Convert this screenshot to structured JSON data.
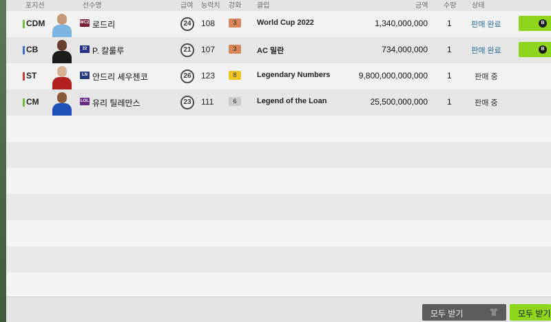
{
  "header": {
    "position": "포지션",
    "player": "선수명",
    "pay": "급여",
    "ovr": "능력치",
    "grade": "강화",
    "club": "클럽",
    "price": "금액",
    "qty": "수량",
    "status": "상태"
  },
  "rows": [
    {
      "position": "CDM",
      "position_color": "#6fbf3a",
      "season": "WC22",
      "season_color": "#7a1f35",
      "name": "로드리",
      "pay": "24",
      "ovr": "108",
      "grade": "3",
      "grade_color": "#d9865a",
      "club": "World Cup 2022",
      "price": "1,340,000,000",
      "qty": "1",
      "status": "판매 완료",
      "status_type": "done",
      "receive": true,
      "coin_icon": "coin-icon",
      "kit_colors": [
        "#7cb5e0",
        "#c49a7a"
      ]
    },
    {
      "position": "CB",
      "position_color": "#3e6fc9",
      "season": "22",
      "season_color": "#2a2f8a",
      "name": "P. 칼룰루",
      "pay": "21",
      "ovr": "107",
      "grade": "3",
      "grade_color": "#d9865a",
      "club": "AC 밀란",
      "price": "734,000,000",
      "qty": "1",
      "status": "판매 완료",
      "status_type": "done",
      "receive": true,
      "coin_icon": "coin-icon",
      "kit_colors": [
        "#1c1c1c",
        "#6a4030"
      ]
    },
    {
      "position": "ST",
      "position_color": "#d63a2f",
      "season": "LN",
      "season_color": "#243a7a",
      "name": "안드리 셰우첸코",
      "pay": "26",
      "ovr": "123",
      "grade": "8",
      "grade_color": "#f0c420",
      "club": "Legendary Numbers",
      "price": "9,800,000,000,000",
      "qty": "1",
      "status": "판매 중",
      "status_type": "selling",
      "receive": false,
      "kit_colors": [
        "#b32020",
        "#d9b090"
      ]
    },
    {
      "position": "CM",
      "position_color": "#6fbf3a",
      "season": "LOL",
      "season_color": "#6a2a8a",
      "name": "유리 틸레만스",
      "pay": "23",
      "ovr": "111",
      "grade": "6",
      "grade_color": "#c9ccd1",
      "club": "Legend of the Loan",
      "price": "25,500,000,000",
      "qty": "1",
      "status": "판매 중",
      "status_type": "selling",
      "receive": false,
      "kit_colors": [
        "#1f4fb8",
        "#8a5a3a"
      ]
    }
  ],
  "footer": {
    "receive_all_gray": "모두 받기",
    "receive_all_green": "모두 받기",
    "shirt_icon": "shirt-icon"
  }
}
